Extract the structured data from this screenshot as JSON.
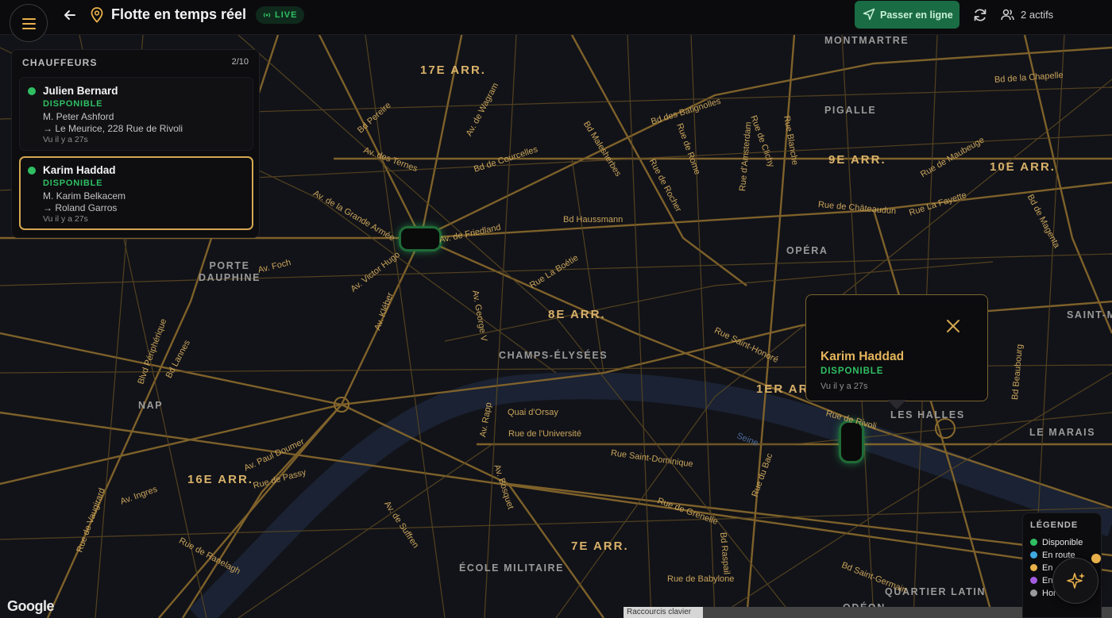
{
  "header": {
    "title": "Flotte en temps réel",
    "live_label": "LIVE",
    "go_online_label": "Passer en ligne",
    "active_count": "2 actifs"
  },
  "drivers_panel": {
    "title": "CHAUFFEURS",
    "count": "2/10",
    "drivers": [
      {
        "name": "Julien Bernard",
        "status": "DISPONIBLE",
        "client": "M. Peter Ashford",
        "destination": "→ Le Meurice, 228 Rue de Rivoli",
        "last_seen": "Vu il y a 27s",
        "selected": false
      },
      {
        "name": "Karim Haddad",
        "status": "DISPONIBLE",
        "client": "M. Karim Belkacem",
        "destination": "→ Roland Garros",
        "last_seen": "Vu il y a 27s",
        "selected": true
      }
    ]
  },
  "popup": {
    "name": "Karim Haddad",
    "status": "DISPONIBLE",
    "last_seen": "Vu il y a 27s"
  },
  "legend": {
    "title": "LÉGENDE",
    "items": [
      {
        "label": "Disponible",
        "color": "#2fbf62"
      },
      {
        "label": "En route",
        "color": "#3fa9e0"
      },
      {
        "label": "En",
        "color": "#e8b04a"
      },
      {
        "label": "En",
        "color": "#a35be0"
      },
      {
        "label": "Hor",
        "color": "#9a9a9a"
      }
    ]
  },
  "map": {
    "arrondissements": [
      "17E ARR.",
      "9E ARR.",
      "10E ARR.",
      "8E ARR.",
      "16E ARR.",
      "7E ARR.",
      "1ER AR"
    ],
    "districts": [
      "MONTMARTRE",
      "PIGALLE",
      "OPÉRA",
      "PORTE DAUPHINE",
      "CHAMPS-ÉLYSÉES",
      "NAP",
      "LES HALLES",
      "LE MARAIS",
      "ÉCOLE MILITAIRE",
      "QUARTIER LATIN",
      "ODÉON",
      "SAINT-M"
    ],
    "streets": [
      "Bd Pereire",
      "Av. de Wagram",
      "Av. des Ternes",
      "Bd de Courcelles",
      "Bd Malesherbes",
      "Bd des Batignolles",
      "Av. de la Grande Armée",
      "Av. de Friedland",
      "Av. Foch",
      "Av. Victor Hugo",
      "Bd Haussmann",
      "Rue de Rome",
      "Rue La Boétie",
      "Rue Saint-Honoré",
      "Rue de Châteaudun",
      "Rue La Fayette",
      "Bd de Magenta",
      "Rue de Maubeuge",
      "Av. Kléber",
      "Quai d'Orsay",
      "Rue de l'Université",
      "Rue Saint-Dominique",
      "Rue de Grenelle",
      "Av. Paul Doumer",
      "Rue de Passy",
      "Seine",
      "Rue de Rivoli",
      "Rue de Babylone",
      "Bd Saint-Germain",
      "Av. Bosquet",
      "Av. Rapp",
      "Av. George V",
      "Bd Lannes",
      "Blvd Périphérique",
      "Rue La Fayette",
      "Rue de Vaugirard",
      "Rue Blanche",
      "Rue de Clichy",
      "Rue d'Amsterdam",
      "Bd de la Chapelle",
      "Rue de Rocher",
      "Av. Ingres",
      "Av. de Suffren",
      "Rue de Ranelagh",
      "Bd Raspail",
      "Rue du Bac",
      "Bd Beaubourg"
    ],
    "attribution": "Google",
    "keyboard_shortcuts": "Raccourcis clavier"
  }
}
